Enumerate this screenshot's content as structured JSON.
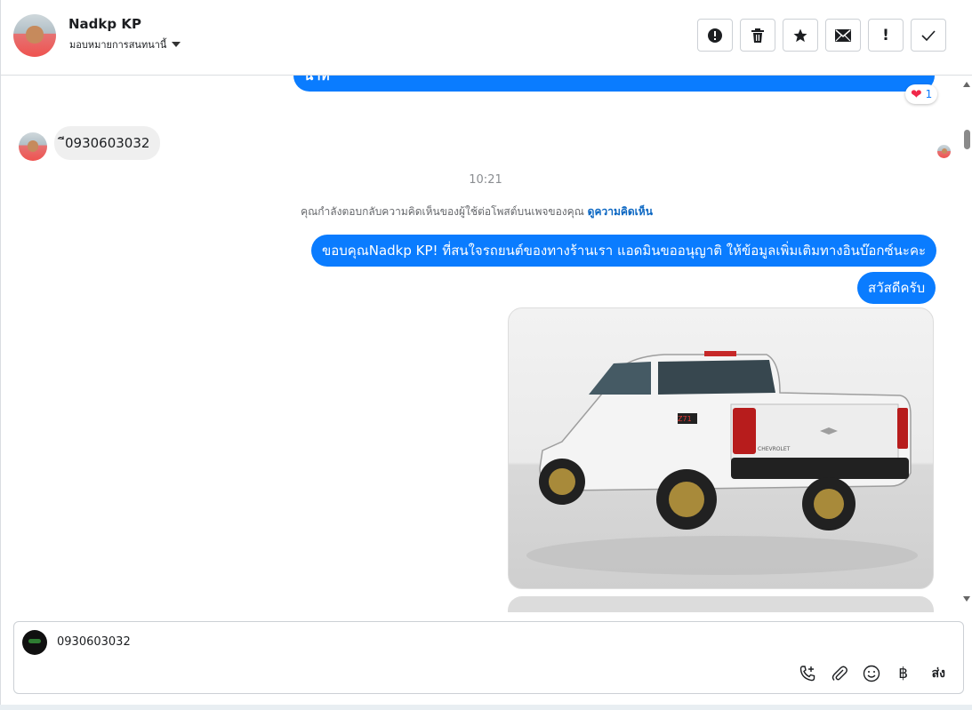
{
  "header": {
    "name": "Nadkp KP",
    "assign_label": "มอบหมายการสนทนานี้"
  },
  "toolbar": {
    "spam": "!",
    "trash": "🗑",
    "star": "★",
    "unread": "✉",
    "follow_up": "!",
    "done": "✓"
  },
  "chat": {
    "partial_message": "นาที",
    "reaction_count": "1",
    "incoming_message": "ี0930603032",
    "time": "10:21",
    "notice_text": "คุณกำลังตอบกลับความคิดเห็นของผู้ใช้ต่อโพสต์บนเพจของคุณ",
    "notice_link": "ดูความคิดเห็น",
    "reply_1": "ขอบคุณNadkp KP! ที่สนใจรถยนต์ของทางร้านเรา แอดมินขออนุญาติ ให้ข้อมูลเพิ่มเติมทางอินบ๊อกซ์นะคะ",
    "reply_2": "สวัสดีครับ",
    "photo_badge": "Z71",
    "photo_brand": "CHEVROLET"
  },
  "composer": {
    "value": "0930603032",
    "send_label": "ส่ง",
    "baht_symbol": "฿"
  }
}
